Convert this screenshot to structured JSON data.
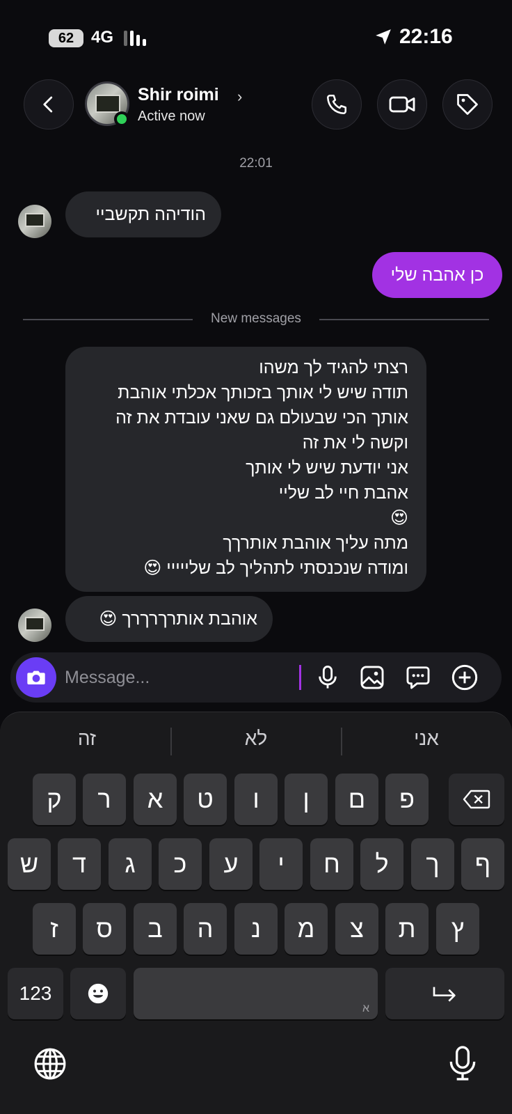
{
  "status_bar": {
    "battery": "62",
    "network": "4G",
    "time": "22:16"
  },
  "header": {
    "contact_name": "Shir roimi",
    "contact_status": "Active now",
    "chevron": "›",
    "icons": [
      "back-arrow-icon",
      "phone-icon",
      "video-camera-icon",
      "tag-icon"
    ]
  },
  "conversation": {
    "timestamp": "22:01",
    "messages": [
      {
        "from": "them",
        "lines": [
          "הודיהה תקשביי"
        ]
      },
      {
        "from": "me",
        "lines": [
          "כן אהבה שלי"
        ]
      },
      {
        "from": "them",
        "lines": [
          "רצתי להגיד לך משהו",
          "תודה שיש לי אותך בזכותך אכלתי אוהבת",
          "אותך הכי שבעולם גם  שאני עובדת את זה",
          "וקשה לי את זה",
          "אני יודעת שיש לי אותך",
          "אהבת חיי לב שליי",
          "😍",
          "מתה עליך אוהבת אותרךך",
          "ומודה שנכנסתי לתהליך לב שלייייי 😍"
        ]
      },
      {
        "from": "them",
        "lines": [
          "אוהבת אותרךרךרך 😍"
        ]
      }
    ],
    "new_messages_label": "New messages"
  },
  "composer": {
    "placeholder": "Message...",
    "icons": [
      "camera-icon",
      "microphone-icon",
      "image-icon",
      "sticker-chat-icon",
      "add-icon"
    ]
  },
  "keyboard": {
    "suggestions": [
      "אני",
      "לא",
      "זה"
    ],
    "row1": [
      "ק",
      "ר",
      "א",
      "ט",
      "ו",
      "ן",
      "ם",
      "פ"
    ],
    "row2": [
      "ש",
      "ד",
      "ג",
      "כ",
      "ע",
      "י",
      "ח",
      "ל",
      "ך",
      "ף"
    ],
    "row3": [
      "ז",
      "ס",
      "ב",
      "ה",
      "נ",
      "מ",
      "צ",
      "ת",
      "ץ"
    ],
    "numbers_key": "123",
    "space_sub": "א",
    "colors": {
      "accent": "#a232e3",
      "camera": "#6a3df5",
      "online": "#2fd158"
    }
  }
}
